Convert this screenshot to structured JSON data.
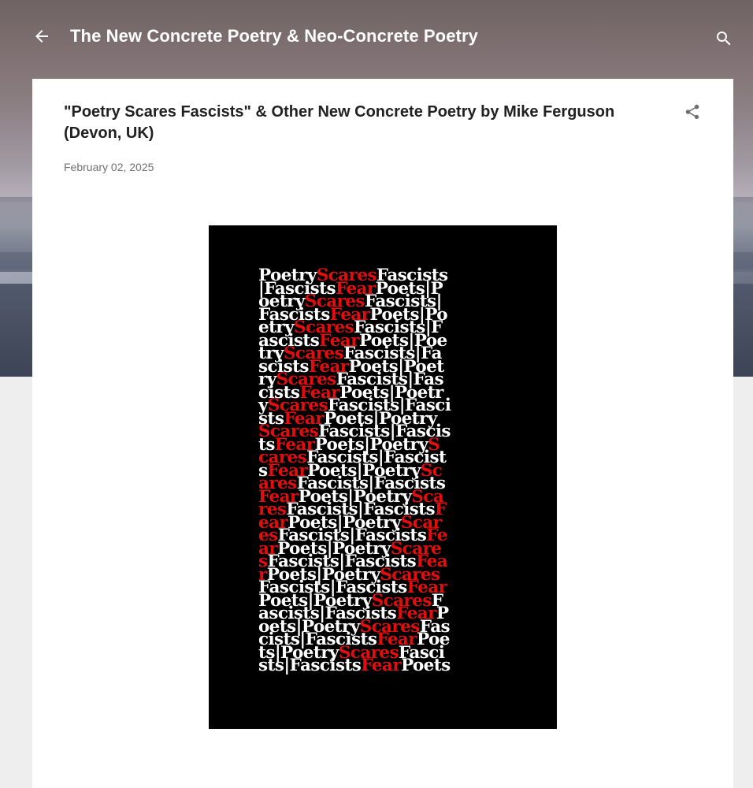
{
  "header": {
    "blog_title": "The New Concrete Poetry & Neo-Concrete Poetry",
    "back_icon": "arrow-back-icon",
    "search_icon": "search-icon"
  },
  "post": {
    "title": "\"Poetry Scares Fascists\" & Other New Concrete Poetry by Mike Ferguson (Devon, UK)",
    "date": "February 02, 2025",
    "share_icon": "share-icon"
  },
  "poem_image": {
    "colors": {
      "background": "#000000",
      "text": "#ffffff",
      "accent": "#e30d0d"
    },
    "lines": [
      [
        [
          "Poetry",
          0
        ],
        [
          "Scares",
          1
        ],
        [
          "Fascists",
          0
        ]
      ],
      [
        [
          "|Fascists",
          0
        ],
        [
          "Fear",
          1
        ],
        [
          "Poets|P",
          0
        ]
      ],
      [
        [
          "oetry",
          0
        ],
        [
          "Scares",
          1
        ],
        [
          "Fascists|",
          0
        ]
      ],
      [
        [
          "Fascists",
          0
        ],
        [
          "Fear",
          1
        ],
        [
          "Poets|Po",
          0
        ]
      ],
      [
        [
          "etry",
          0
        ],
        [
          "Scares",
          1
        ],
        [
          "Fascists|F",
          0
        ]
      ],
      [
        [
          "ascists",
          0
        ],
        [
          "Fear",
          1
        ],
        [
          "Poets|Poe",
          0
        ]
      ],
      [
        [
          "try",
          0
        ],
        [
          "Scares",
          1
        ],
        [
          "Fascists|Fa",
          0
        ]
      ],
      [
        [
          "scists",
          0
        ],
        [
          "Fear",
          1
        ],
        [
          "Poets|Poet",
          0
        ]
      ],
      [
        [
          "ry",
          0
        ],
        [
          "Scares",
          1
        ],
        [
          "Fascists|Fas",
          0
        ]
      ],
      [
        [
          "cists",
          0
        ],
        [
          "Fear",
          1
        ],
        [
          "Poets|Poetr",
          0
        ]
      ],
      [
        [
          "y",
          0
        ],
        [
          "Scares",
          1
        ],
        [
          "Fascists|Fasci",
          0
        ]
      ],
      [
        [
          "sts",
          0
        ],
        [
          "Fear",
          1
        ],
        [
          "Poets|Poetry",
          0
        ]
      ],
      [
        [
          "Scares",
          1
        ],
        [
          "Fascists|Fascis",
          0
        ]
      ],
      [
        [
          "ts",
          0
        ],
        [
          "Fear",
          1
        ],
        [
          "Poets|Poetry",
          0
        ],
        [
          "S",
          1
        ]
      ],
      [
        [
          "cares",
          1
        ],
        [
          "Fascists|Fascist",
          0
        ]
      ],
      [
        [
          "s",
          0
        ],
        [
          "Fear",
          1
        ],
        [
          "Poets|Poetry",
          0
        ],
        [
          "Sc",
          1
        ]
      ],
      [
        [
          "ares",
          1
        ],
        [
          "Fascists|Fascists",
          0
        ]
      ],
      [
        [
          "Fear",
          1
        ],
        [
          "Poets|Poetry",
          0
        ],
        [
          "Sca",
          1
        ]
      ],
      [
        [
          "res",
          1
        ],
        [
          "Fascists|Fascists",
          0
        ],
        [
          "F",
          1
        ]
      ],
      [
        [
          "ear",
          1
        ],
        [
          "Poets|Poetry",
          0
        ],
        [
          "Scar",
          1
        ]
      ],
      [
        [
          "es",
          1
        ],
        [
          "Fascists|Fascists",
          0
        ],
        [
          "Fe",
          1
        ]
      ],
      [
        [
          "ar",
          1
        ],
        [
          "Poets|Poetry",
          0
        ],
        [
          "Scare",
          1
        ]
      ],
      [
        [
          "s",
          1
        ],
        [
          "Fascists|Fascists",
          0
        ],
        [
          "Fea",
          1
        ]
      ],
      [
        [
          "r",
          1
        ],
        [
          "Poets|Poetry",
          0
        ],
        [
          "Scares",
          1
        ]
      ],
      [
        [
          "Fascists|Fascists",
          0
        ],
        [
          "Fear",
          1
        ]
      ],
      [
        [
          "Poets|Poetry",
          0
        ],
        [
          "Scares",
          1
        ],
        [
          "F",
          0
        ]
      ],
      [
        [
          "ascists|Fascists",
          0
        ],
        [
          "Fear",
          1
        ],
        [
          "P",
          0
        ]
      ],
      [
        [
          "oets|Poetry",
          0
        ],
        [
          "Scares",
          1
        ],
        [
          "Fas",
          0
        ]
      ],
      [
        [
          "cists|Fascists",
          0
        ],
        [
          "Fear",
          1
        ],
        [
          "Poe",
          0
        ]
      ],
      [
        [
          "ts|Poetry",
          0
        ],
        [
          "Scares",
          1
        ],
        [
          "Fasci",
          0
        ]
      ],
      [
        [
          "sts|Fascists",
          0
        ],
        [
          "Fear",
          1
        ],
        [
          "Poets",
          0
        ]
      ]
    ]
  }
}
